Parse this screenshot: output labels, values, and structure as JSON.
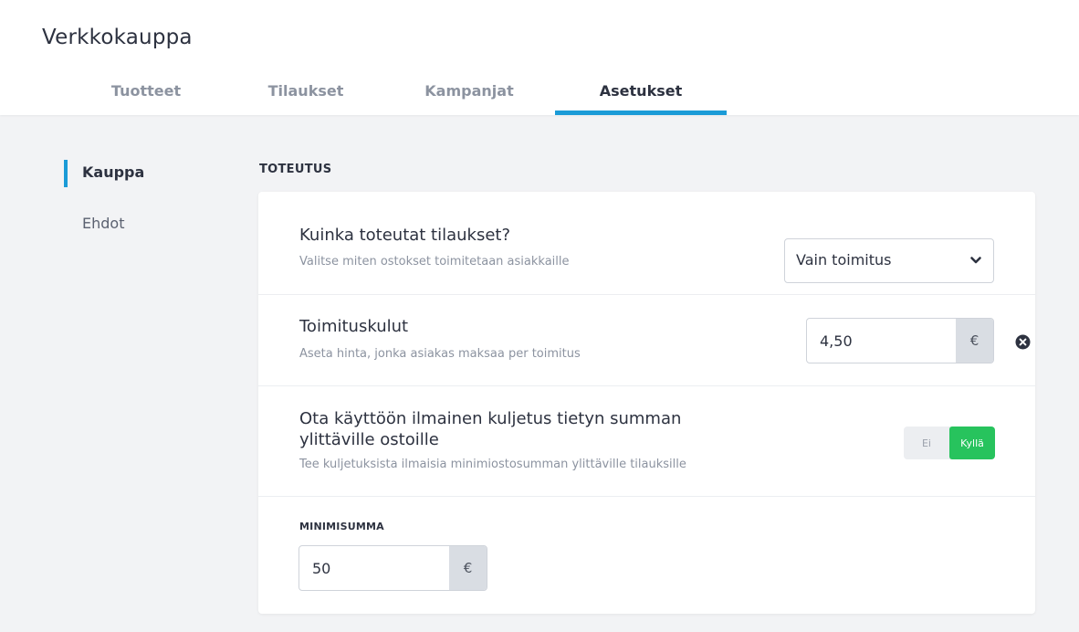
{
  "app": {
    "title": "Verkkokauppa"
  },
  "tabs": [
    {
      "label": "Tuotteet"
    },
    {
      "label": "Tilaukset"
    },
    {
      "label": "Kampanjat"
    },
    {
      "label": "Asetukset"
    }
  ],
  "active_tab": "Asetukset",
  "sidebar": {
    "items": [
      {
        "label": "Kauppa"
      },
      {
        "label": "Ehdot"
      }
    ],
    "active": "Kauppa"
  },
  "section": {
    "label": "TOTEUTUS"
  },
  "fulfillment": {
    "title": "Kuinka toteutat tilaukset?",
    "description": "Valitse miten ostokset toimitetaan asiakkaille",
    "selected": "Vain toimitus"
  },
  "shipping": {
    "title": "Toimituskulut",
    "description": "Aseta hinta, jonka asiakas maksaa per toimitus",
    "value": "4,50",
    "currency": "€"
  },
  "free_shipping": {
    "title_line1": "Ota käyttöön ilmainen kuljetus tietyn summan",
    "title_line2": "ylittäville ostoille",
    "description": "Tee kuljetuksista ilmaisia minimiostosumman ylittäville tilauksille",
    "toggle_off": "Ei",
    "toggle_on": "Kyllä",
    "enabled": true
  },
  "minimum": {
    "label": "MINIMISUMMA",
    "value": "50",
    "currency": "€"
  },
  "colors": {
    "accent": "#1b9bd7",
    "toggle_on": "#27c35d",
    "text": "#2d3240",
    "muted": "#8c93a0",
    "background": "#f2f3f5"
  },
  "icons": {
    "select": "chevron-down-icon",
    "clear": "close-circle-icon"
  }
}
